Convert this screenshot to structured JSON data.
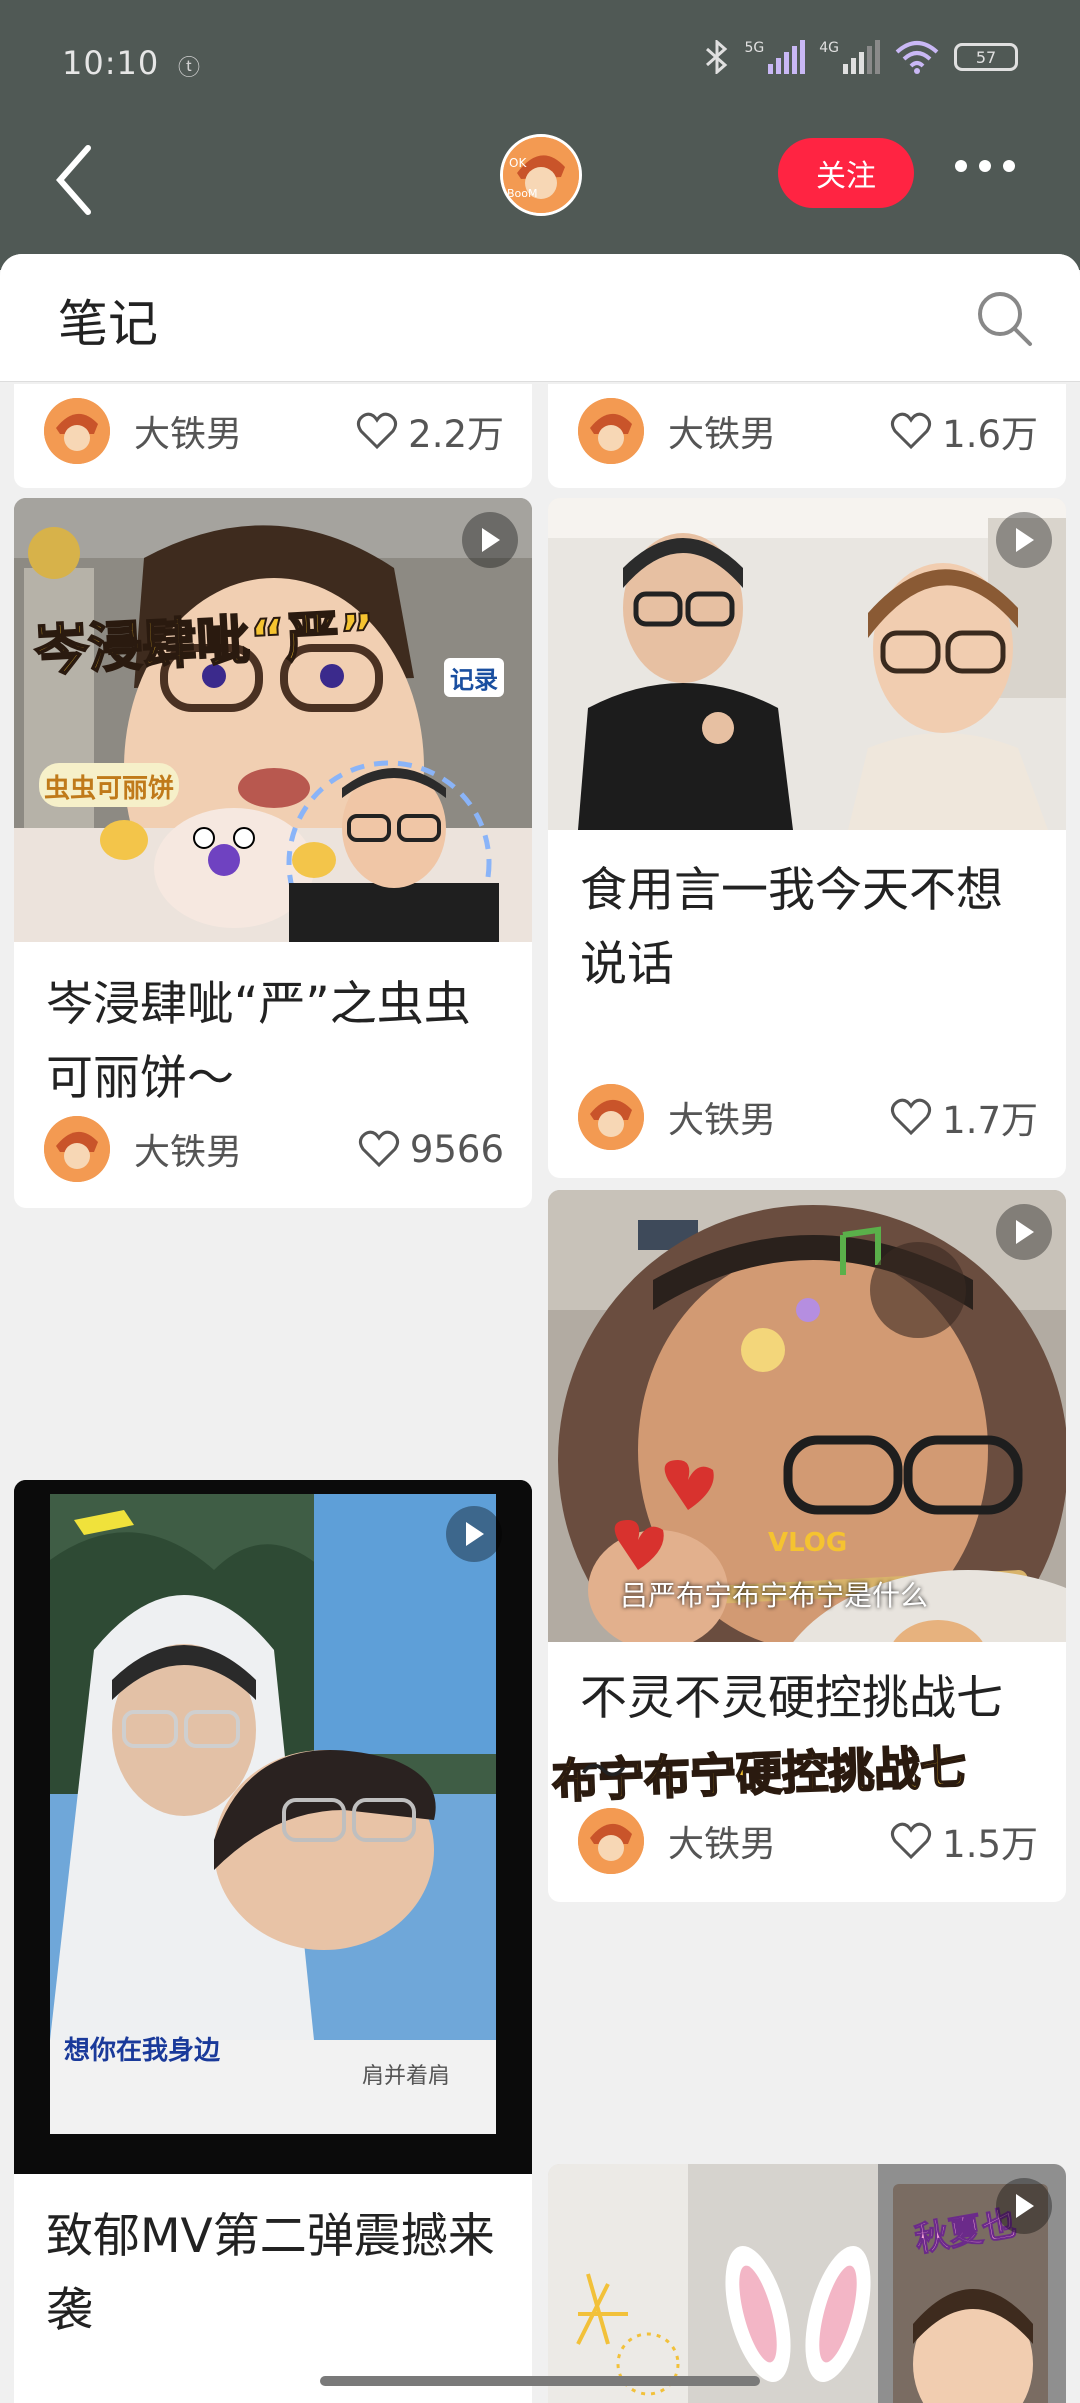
{
  "status_bar": {
    "time": "10:10",
    "small_icon": "ⓣ",
    "net_5g": "5G",
    "net_4g": "4G",
    "battery": "57"
  },
  "header": {
    "follow_label": "关注",
    "avatar_text": "OK BooM"
  },
  "section": {
    "title": "笔记"
  },
  "colors": {
    "accent": "#ff2442",
    "topbar": "#505955",
    "avatar_orange": "#f39a52"
  },
  "icons": {
    "back": "chevron-left-icon",
    "more": "more-dots-icon",
    "search": "search-icon",
    "like": "heart-outline-icon",
    "play": "play-icon"
  },
  "notes": [
    {
      "title": "",
      "author": "大铁男",
      "likes": "2.2万"
    },
    {
      "title": "",
      "author": "大铁男",
      "likes": "1.6万"
    },
    {
      "title": "岑浸肆呲“严”之虫虫可丽饼～",
      "author": "大铁男",
      "likes": "9566",
      "overlay": "岑浸肆呲“严”",
      "overlay2": "虫虫可丽饼",
      "overlay3": "记录"
    },
    {
      "title": "食用言一我今天不想说话",
      "author": "大铁男",
      "likes": "1.7万"
    },
    {
      "title": "不灵不灵硬控挑战七～",
      "author": "大铁男",
      "likes": "1.5万",
      "overlay": "布宁布宁硬控挑战七",
      "overlay2": "VLOG",
      "caption": "吕严布宁布宁布宁是什么"
    },
    {
      "title": "致郁MV第二弹震撼来袭",
      "author": "",
      "likes": "",
      "caption": "想你在我身边",
      "caption2": "肩并着肩"
    },
    {
      "title": "",
      "author": "",
      "likes": "",
      "overlay": "秋夏也"
    }
  ]
}
